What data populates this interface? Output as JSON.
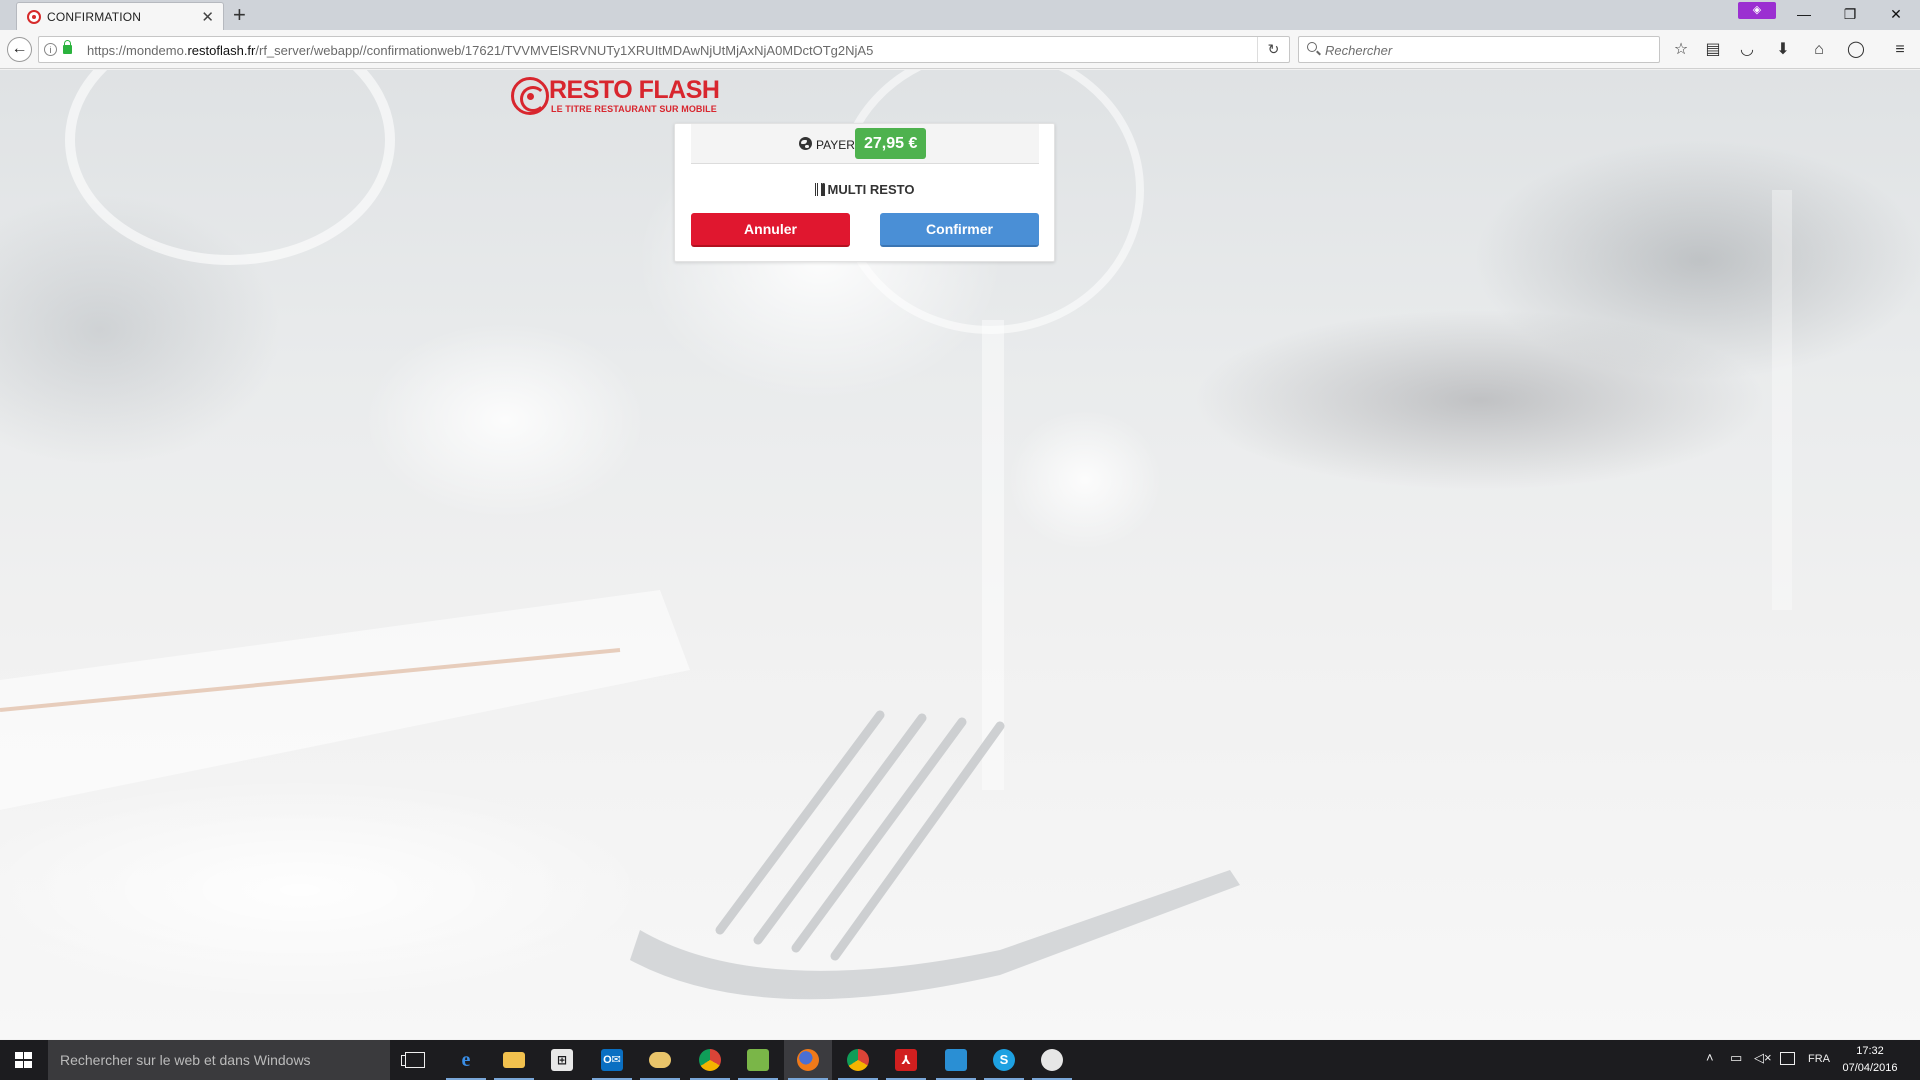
{
  "browser": {
    "tab": {
      "title": "CONFIRMATION"
    },
    "url": {
      "prefix": "https://mondemo.",
      "domain": "restoflash.fr",
      "path": "/rf_server/webapp//confirmationweb/17621/TVVMVElSRVNUTy1XRUItMDAwNjUtMjAxNjA0MDctOTg2NjA5"
    },
    "search": {
      "placeholder": "Rechercher"
    }
  },
  "logo": {
    "brand": "RESTO FLASH",
    "tagline": "LE TITRE RESTAURANT SUR MOBILE"
  },
  "confirmation": {
    "pay_label": "PAYER",
    "amount": "27,95 €",
    "restaurant": "MULTI RESTO",
    "cancel_label": "Annuler",
    "confirm_label": "Confirmer"
  },
  "colors": {
    "brand_red": "#d8262e",
    "amount_green": "#4eb24e",
    "cancel_red": "#e0172f",
    "confirm_blue": "#4a8fd6"
  },
  "taskbar": {
    "search_placeholder": "Rechercher sur le web et dans Windows",
    "language": "FRA",
    "time": "17:32",
    "date": "07/04/2016",
    "apps": [
      "edge-icon",
      "file-explorer-icon",
      "store-icon",
      "outlook-icon",
      "cloud-drive-icon",
      "chrome-icon",
      "notepad-icon",
      "firefox-icon",
      "chrome-user-icon",
      "acrobat-icon",
      "remote-desktop-icon",
      "skype-icon",
      "paint-icon"
    ]
  }
}
